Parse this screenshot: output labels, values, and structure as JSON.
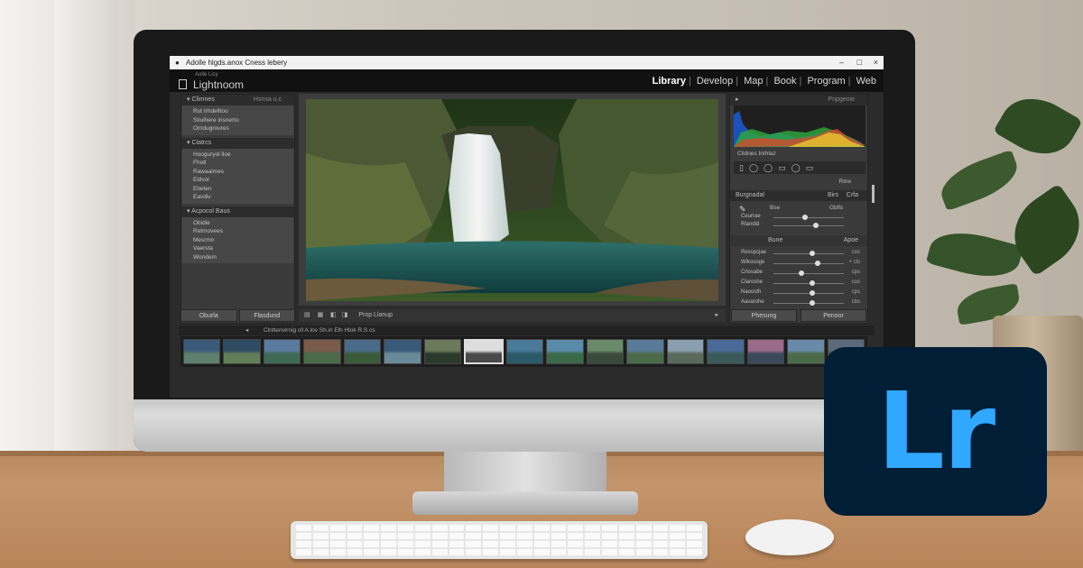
{
  "window": {
    "title": "Adolle hlgds.anox Cness lebery",
    "controls": [
      "–",
      "□",
      "×"
    ]
  },
  "app": {
    "logo_small": "Aolle Licy",
    "logo_name": "Lightnoom",
    "modules": [
      "Library",
      "Develop",
      "Map",
      "Book",
      "Program",
      "Web"
    ],
    "active_module": "Library"
  },
  "left_panel": {
    "sections": [
      {
        "title": "Climnes",
        "aside": "Hsnsa u.c",
        "items": [
          "Rut Irhdelltoo",
          "Stiulhere insnerto",
          "Omdugroures"
        ]
      },
      {
        "title": "Clatrcs",
        "aside": "",
        "items": [
          "Hooguryol lloe",
          "Fhotl",
          "Rawaaimes",
          "Eldvol",
          "Ebeten",
          "Eavdiv"
        ]
      },
      {
        "title": "Acpocol Baus",
        "aside": "",
        "items": [
          "Obidie",
          "Retmovees",
          "Mesrmn",
          "Vaersta",
          "Wondem"
        ]
      }
    ],
    "buttons": [
      "Oburla",
      "Flasdund"
    ]
  },
  "toolbar": {
    "label": "Prop Llanup"
  },
  "right_panel": {
    "header": "Pnpgenie",
    "histogram_caption": "Clidnes  Inthlaz",
    "section_label": "Rine",
    "basic": {
      "title": "Burgnadal",
      "tabs": [
        "Birs",
        "Crfa"
      ],
      "cols": [
        "Bse",
        "Gbfls"
      ]
    },
    "wb_sliders": [
      {
        "label": "Ceurrae",
        "pos": 0.45
      },
      {
        "label": "Rlandid",
        "pos": 0.6
      }
    ],
    "tone": {
      "title": "Bune",
      "aside": "Apoe"
    },
    "sliders": [
      {
        "label": "Resspcjae",
        "pos": 0.55,
        "value": "cos"
      },
      {
        "label": "Wikosoge",
        "pos": 0.63,
        "value": "+ cls"
      },
      {
        "label": "Criosabe",
        "pos": 0.4,
        "value": "cps"
      },
      {
        "label": "Claroshe",
        "pos": 0.55,
        "value": "cos"
      },
      {
        "label": "Naoosth",
        "pos": 0.55,
        "value": "cps"
      },
      {
        "label": "Aavarohe",
        "pos": 0.55,
        "value": "cbs"
      }
    ],
    "buttons": [
      "Phesung",
      "Penoor"
    ]
  },
  "filmstrip": {
    "info": "Clnttenvirnig cll A.lov Sh.in Elh Hlok R.S cs",
    "count": 17,
    "selected_index": 7
  },
  "badge": {
    "text": "Lr"
  },
  "colors": {
    "lr_blue": "#31a8ff",
    "lr_navy": "#001e36"
  }
}
